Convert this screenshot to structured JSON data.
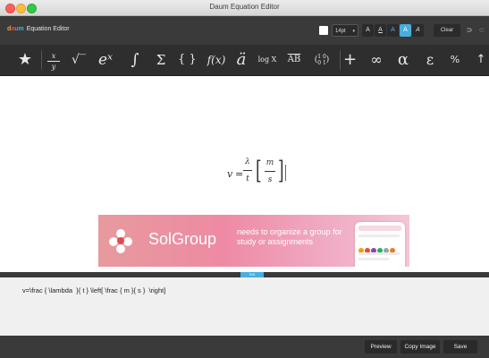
{
  "window": {
    "title": "Daum Equation Editor"
  },
  "app": {
    "brand": [
      "d",
      "a",
      "u",
      "m"
    ],
    "name": "Equation Editor"
  },
  "options": {
    "font_size": "14pt",
    "format_buttons": [
      "A",
      "A",
      "A",
      "A",
      "A"
    ],
    "active_format_index": 3,
    "clear_label": "Clear",
    "undo_glyph": "⊃",
    "redo_glyph": "⊂"
  },
  "symbols": [
    {
      "name": "star",
      "glyph": "★"
    },
    {
      "name": "fraction",
      "glyph": "x/y"
    },
    {
      "name": "root",
      "glyph": "√‾"
    },
    {
      "name": "exponent",
      "glyph": "eˣ"
    },
    {
      "name": "integral",
      "glyph": "∫"
    },
    {
      "name": "sum",
      "glyph": "Σ"
    },
    {
      "name": "brackets",
      "glyph": "{ }"
    },
    {
      "name": "function",
      "glyph": "f(x)"
    },
    {
      "name": "accent",
      "glyph": "ä"
    },
    {
      "name": "log",
      "glyph": "log X"
    },
    {
      "name": "overline",
      "glyph": "AB"
    },
    {
      "name": "matrix",
      "glyph": "(1 0 / 0 1)"
    },
    {
      "name": "plus",
      "glyph": "+"
    },
    {
      "name": "infinity",
      "glyph": "∞"
    },
    {
      "name": "alpha",
      "glyph": "α"
    },
    {
      "name": "epsilon",
      "glyph": "ε"
    },
    {
      "name": "percent",
      "glyph": "%"
    },
    {
      "name": "arrow",
      "glyph": "↑"
    }
  ],
  "formula": {
    "lhs": "v",
    "eq": "=",
    "frac1": {
      "num": "λ",
      "den": "t"
    },
    "frac2": {
      "num": "m",
      "den": "s"
    },
    "left_bracket": "[",
    "right_bracket": "]"
  },
  "ad": {
    "brand": "SolGroup",
    "copy": "needs to organize a group for study or assignments"
  },
  "tex_tab": "TeX",
  "latex": "v=\\frac { \\lambda  }{ t } \\left[ \\frac { m }{ s }  \\right]",
  "buttons": {
    "preview": "Preview",
    "copy": "Copy Image",
    "save": "Save"
  }
}
